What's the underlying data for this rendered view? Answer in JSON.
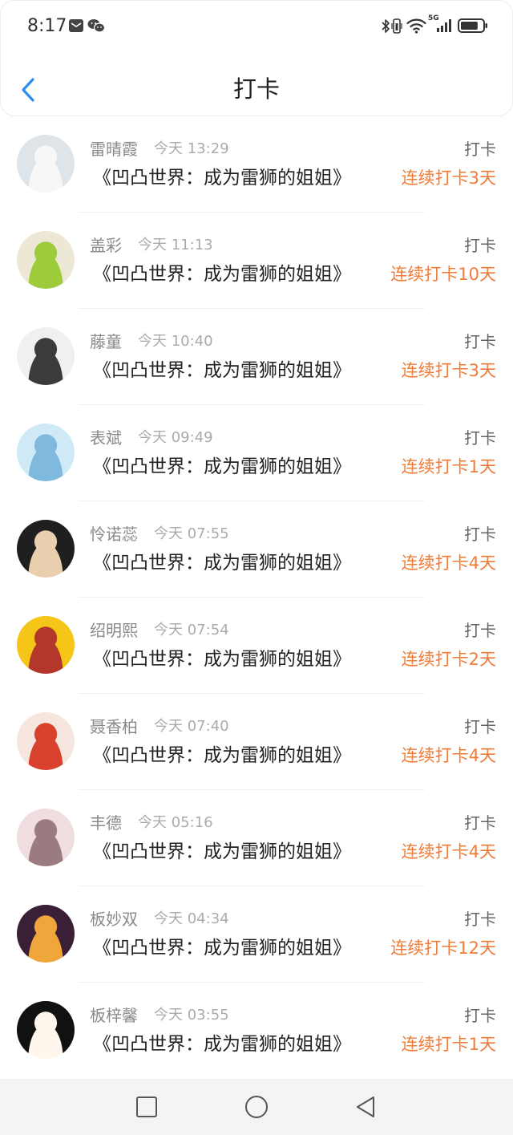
{
  "status_bar": {
    "time": "8:17",
    "network": "5G",
    "battery_level": 0.8,
    "icons": [
      "message-icon",
      "wechat-icon",
      "bluetooth-icon",
      "vibrate-icon",
      "wifi-icon",
      "signal-icon",
      "battery-icon"
    ]
  },
  "header": {
    "title": "打卡",
    "back_icon": "chevron-left-icon"
  },
  "colors": {
    "accent": "#2b8ef0",
    "streak": "#f07c38",
    "name": "#8a8a8a",
    "time": "#ababab",
    "book": "#222222"
  },
  "checkins": [
    {
      "name": "雷晴霞",
      "time": "今天 13:29",
      "action": "打卡",
      "book": "《凹凸世界：成为雷狮的姐姐》",
      "streak": "连续打卡3天",
      "avatar": {
        "bg": "#dfe4e8",
        "fg": "#f7f7f7"
      }
    },
    {
      "name": "盖彩",
      "time": "今天 11:13",
      "action": "打卡",
      "book": "《凹凸世界：成为雷狮的姐姐》",
      "streak": "连续打卡10天",
      "avatar": {
        "bg": "#ede7d6",
        "fg": "#9ccc3a"
      }
    },
    {
      "name": "藤童",
      "time": "今天 10:40",
      "action": "打卡",
      "book": "《凹凸世界：成为雷狮的姐姐》",
      "streak": "连续打卡3天",
      "avatar": {
        "bg": "#eef0f2",
        "fg": "#3b3b3b"
      }
    },
    {
      "name": "表斌",
      "time": "今天 09:49",
      "action": "打卡",
      "book": "《凹凸世界：成为雷狮的姐姐》",
      "streak": "连续打卡1天",
      "avatar": {
        "bg": "#cfe9f7",
        "fg": "#7fb9de"
      }
    },
    {
      "name": "怜诺蕊",
      "time": "今天 07:55",
      "action": "打卡",
      "book": "《凹凸世界：成为雷狮的姐姐》",
      "streak": "连续打卡4天",
      "avatar": {
        "bg": "#1f1f1f",
        "fg": "#e9cfae"
      }
    },
    {
      "name": "绍明熙",
      "time": "今天 07:54",
      "action": "打卡",
      "book": "《凹凸世界：成为雷狮的姐姐》",
      "streak": "连续打卡2天",
      "avatar": {
        "bg": "#f5c518",
        "fg": "#b4372c"
      }
    },
    {
      "name": "聂香柏",
      "time": "今天 07:40",
      "action": "打卡",
      "book": "《凹凸世界：成为雷狮的姐姐》",
      "streak": "连续打卡4天",
      "avatar": {
        "bg": "#f6e6df",
        "fg": "#d8412b"
      }
    },
    {
      "name": "丰德",
      "time": "今天 05:16",
      "action": "打卡",
      "book": "《凹凸世界：成为雷狮的姐姐》",
      "streak": "连续打卡4天",
      "avatar": {
        "bg": "#efdde0",
        "fg": "#9a7b7f"
      }
    },
    {
      "name": "板妙双",
      "time": "今天 04:34",
      "action": "打卡",
      "book": "《凹凸世界：成为雷狮的姐姐》",
      "streak": "连续打卡12天",
      "avatar": {
        "bg": "#3b1f36",
        "fg": "#f0a63a"
      }
    },
    {
      "name": "板梓馨",
      "time": "今天 03:55",
      "action": "打卡",
      "book": "《凹凸世界：成为雷狮的姐姐》",
      "streak": "连续打卡1天",
      "avatar": {
        "bg": "#111111",
        "fg": "#fff7ee"
      }
    }
  ],
  "nav_bar": {
    "icons": [
      "recent-apps-icon",
      "home-icon",
      "back-icon"
    ]
  }
}
